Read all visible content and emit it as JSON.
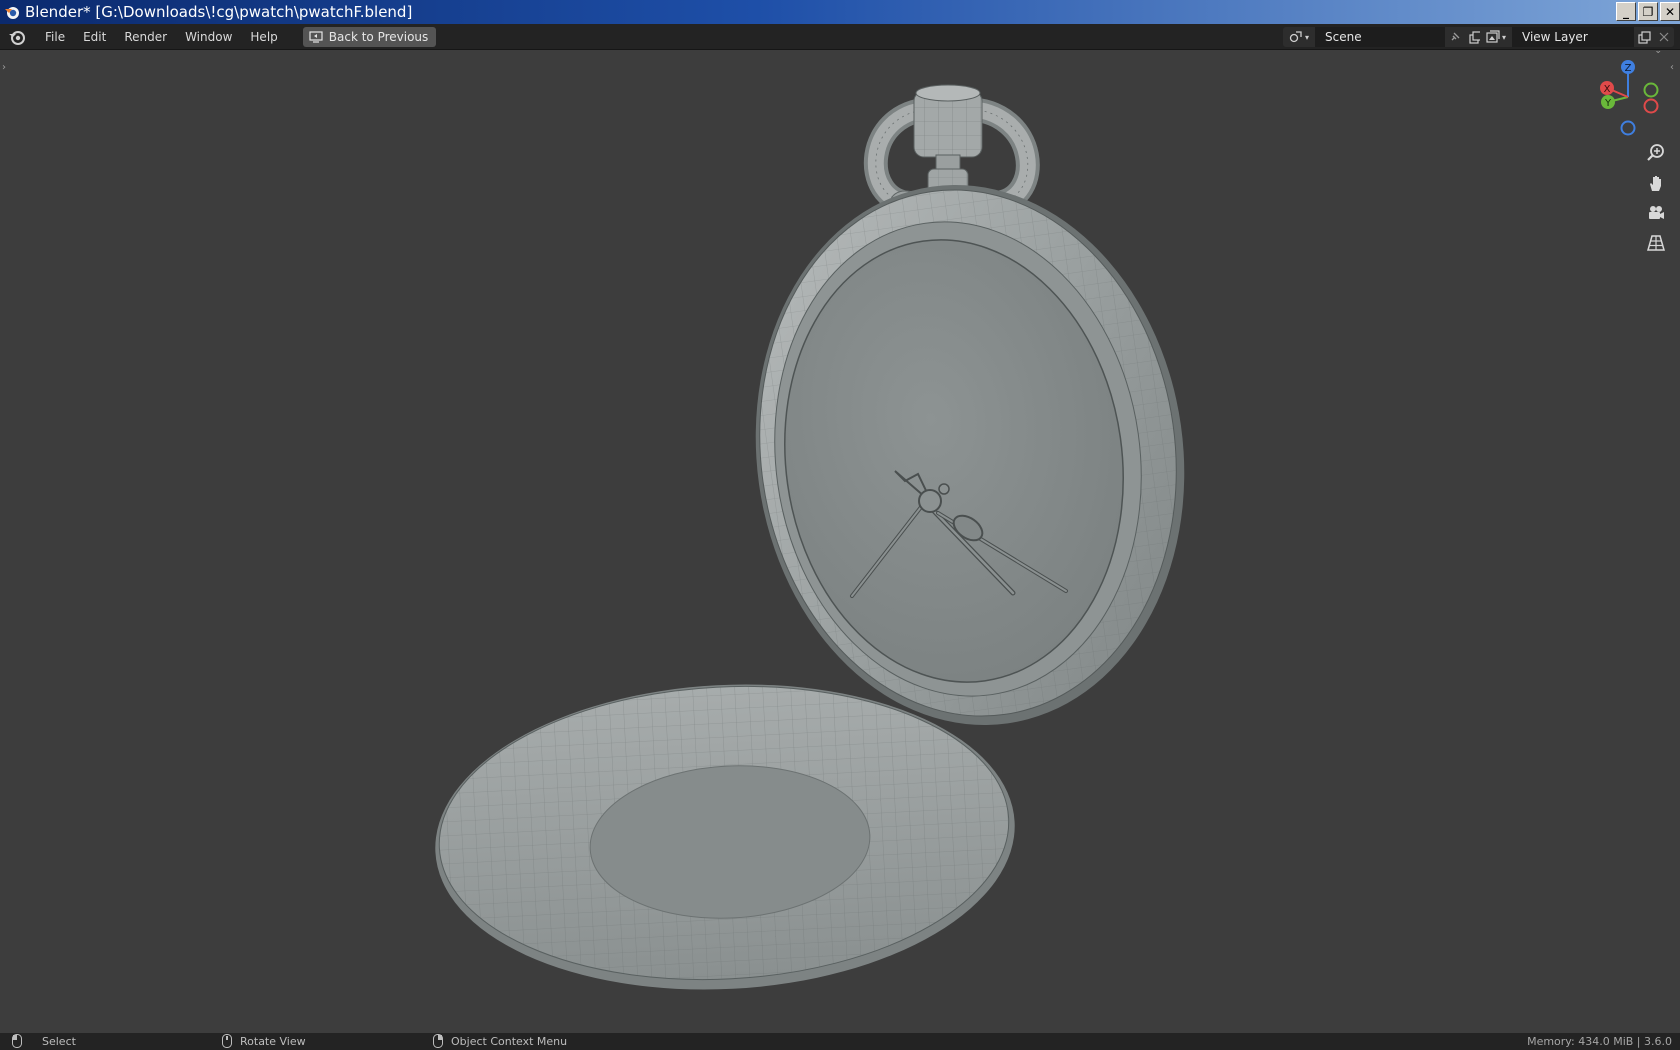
{
  "window": {
    "title": "Blender* [G:\\Downloads\\!cg\\pwatch\\pwatchF.blend]",
    "controls": {
      "minimize": "_",
      "restore": "❐",
      "close": "✕"
    }
  },
  "menubar": {
    "items": [
      "File",
      "Edit",
      "Render",
      "Window",
      "Help"
    ],
    "back_button": "Back to Previous",
    "scene_label": "Scene",
    "view_layer_label": "View Layer"
  },
  "viewport": {
    "gizmo": {
      "z": "Z",
      "x": "X",
      "y": "Y"
    },
    "tools": [
      "zoom-icon",
      "hand-pan-icon",
      "camera-icon",
      "grid-perspective-icon"
    ]
  },
  "statusbar": {
    "left": "Select",
    "middle": "Rotate View",
    "right": "Object Context Menu",
    "info": "Memory: 434.0 MiB | 3.6.0"
  },
  "colors": {
    "titlebar_start": "#0b2a6e",
    "titlebar_end": "#7fa6d8",
    "menubar": "#232323",
    "viewport_bg": "#3d3d3d",
    "axis_x": "#e04a4a",
    "axis_y": "#6ab83a",
    "axis_z": "#3f7fe0"
  }
}
